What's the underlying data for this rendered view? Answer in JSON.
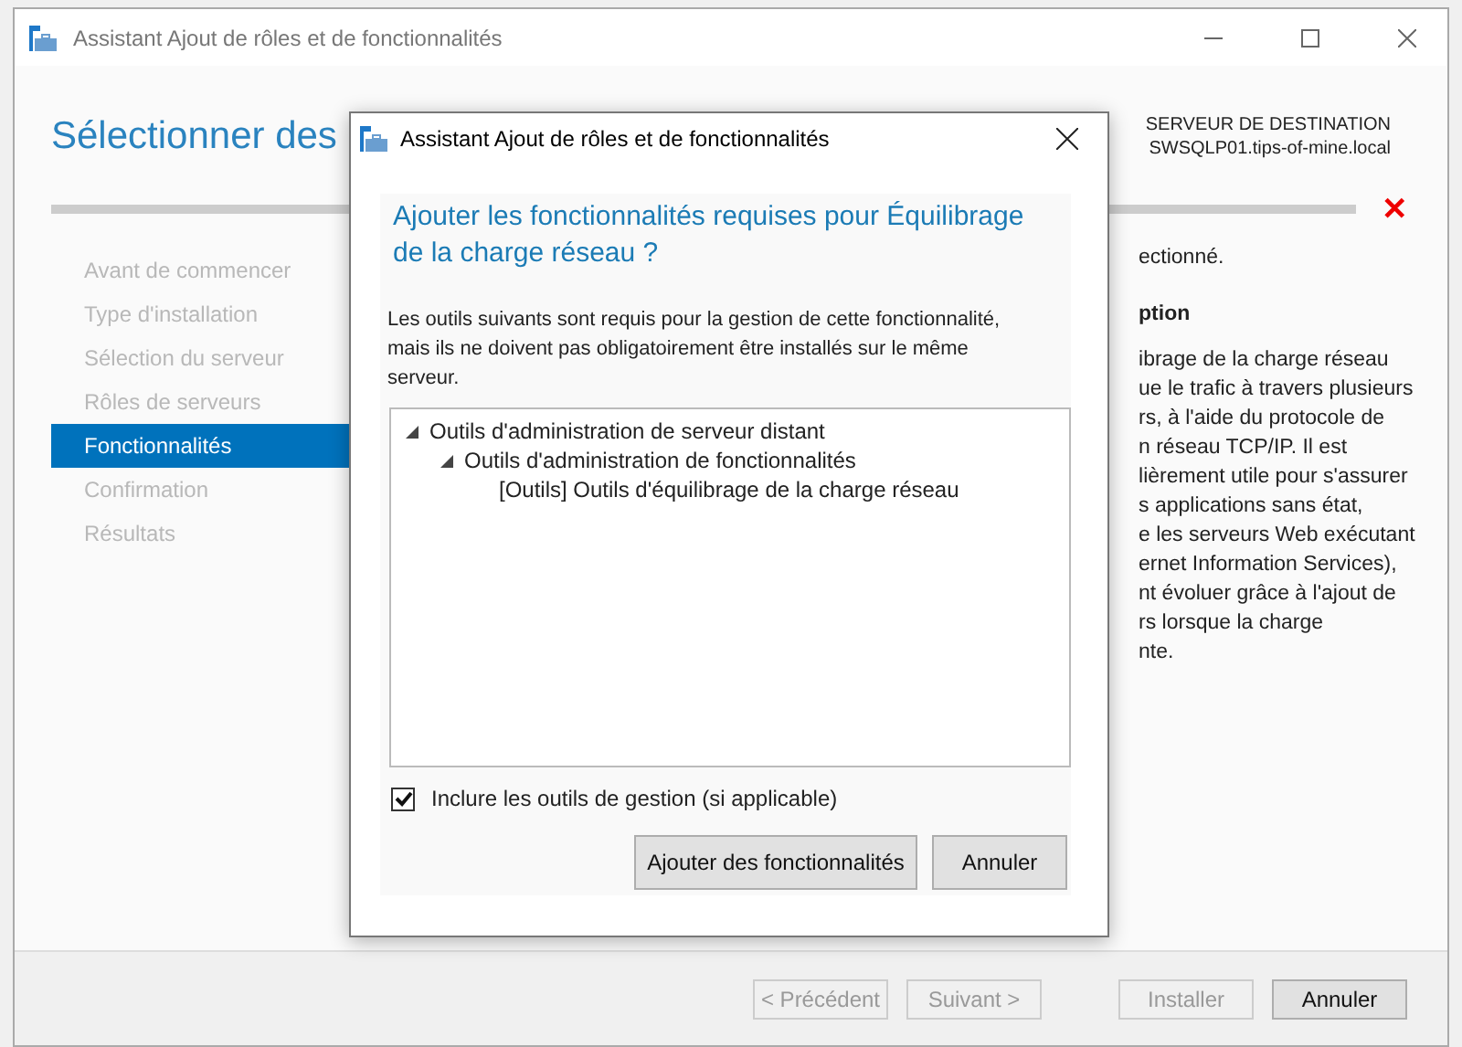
{
  "window": {
    "title": "Assistant Ajout de rôles et de fonctionnalités"
  },
  "page_title": "Sélectionner des",
  "destination": {
    "label": "SERVEUR DE DESTINATION",
    "server": "SWSQLP01.tips-of-mine.local"
  },
  "error_mark": "✕",
  "sidebar": {
    "items": [
      {
        "label": "Avant de commencer",
        "selected": false
      },
      {
        "label": "Type d'installation",
        "selected": false
      },
      {
        "label": "Sélection du serveur",
        "selected": false
      },
      {
        "label": "Rôles de serveurs",
        "selected": false
      },
      {
        "label": "Fonctionnalités",
        "selected": true
      },
      {
        "label": "Confirmation",
        "selected": false
      },
      {
        "label": "Résultats",
        "selected": false
      }
    ]
  },
  "description": {
    "status": "ectionné.",
    "heading": "ption",
    "lines": [
      "ibrage de la charge réseau",
      "ue le trafic à travers plusieurs",
      "rs, à l'aide du protocole de",
      "n réseau TCP/IP. Il est",
      "lièrement utile pour s'assurer",
      "s applications sans état,",
      "e les serveurs Web exécutant",
      "ernet Information Services),",
      "nt évoluer grâce à l'ajout de",
      "rs lorsque la charge",
      "nte."
    ]
  },
  "footer_buttons": [
    {
      "label": "< Précédent",
      "disabled": true
    },
    {
      "label": "Suivant >",
      "disabled": true
    },
    {
      "label": "Installer",
      "disabled": true
    },
    {
      "label": "Annuler",
      "disabled": false
    }
  ],
  "dialog": {
    "title": "Assistant Ajout de rôles et de fonctionnalités",
    "heading": "Ajouter les fonctionnalités requises pour Équilibrage de la charge réseau ?",
    "text": "Les outils suivants sont requis pour la gestion de cette fonctionnalité, mais ils ne doivent pas obligatoirement être installés sur le même serveur.",
    "tree": [
      {
        "label": "Outils d'administration de serveur distant",
        "expanded": true,
        "children": [
          {
            "label": "Outils d'administration de fonctionnalités",
            "expanded": true,
            "children": [
              {
                "label": "[Outils] Outils d'équilibrage de la charge réseau"
              }
            ]
          }
        ]
      }
    ],
    "include_tools": {
      "label": "Inclure les outils de gestion (si applicable)",
      "checked": true
    },
    "buttons": [
      {
        "label": "Ajouter des fonctionnalités"
      },
      {
        "label": "Annuler"
      }
    ]
  }
}
